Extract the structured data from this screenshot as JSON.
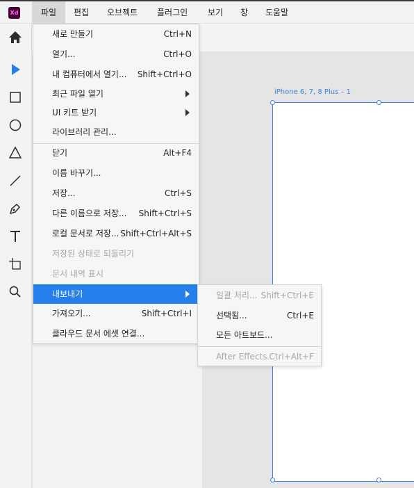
{
  "app": {
    "logo_text": "Xd"
  },
  "menubar": {
    "items": [
      "파일",
      "편집",
      "오브젝트",
      "플러그인",
      "보기",
      "창",
      "도움말"
    ]
  },
  "artboard": {
    "label": "iPhone 6, 7, 8 Plus – 1"
  },
  "file_menu": {
    "items": [
      {
        "label": "새로 만들기",
        "shortcut": "Ctrl+N"
      },
      {
        "label": "열기...",
        "shortcut": "Ctrl+O"
      },
      {
        "label": "내 컴퓨터에서 열기...",
        "shortcut": "Shift+Ctrl+O"
      },
      {
        "label": "최근 파일 열기",
        "shortcut": ""
      },
      {
        "label": "UI 키트 받기",
        "shortcut": ""
      },
      {
        "label": "라이브러리 관리...",
        "shortcut": ""
      },
      {
        "label": "닫기",
        "shortcut": "Alt+F4"
      },
      {
        "label": "이름 바꾸기...",
        "shortcut": ""
      },
      {
        "label": "저장...",
        "shortcut": "Ctrl+S"
      },
      {
        "label": "다른 이름으로 저장...",
        "shortcut": "Shift+Ctrl+S"
      },
      {
        "label": "로컬 문서로 저장...",
        "shortcut": "Shift+Ctrl+Alt+S"
      },
      {
        "label": "저장된 상태로 되돌리기",
        "shortcut": ""
      },
      {
        "label": "문서 내역 표시",
        "shortcut": ""
      },
      {
        "label": "내보내기",
        "shortcut": ""
      },
      {
        "label": "가져오기...",
        "shortcut": "Shift+Ctrl+I"
      },
      {
        "label": "클라우드 문서 에셋 연결...",
        "shortcut": ""
      }
    ]
  },
  "export_submenu": {
    "items": [
      {
        "label": "일괄 처리...",
        "shortcut": "Shift+Ctrl+E"
      },
      {
        "label": "선택됨...",
        "shortcut": "Ctrl+E"
      },
      {
        "label": "모든 아트보드...",
        "shortcut": ""
      },
      {
        "label": "After Effects...",
        "shortcut": "Ctrl+Alt+F"
      }
    ]
  },
  "colors": {
    "accent": "#2680eb",
    "artboard_outline": "#3b82e0",
    "logo_bg": "#470137",
    "logo_fg": "#ff61f6"
  },
  "tools": [
    "home-icon",
    "select-icon",
    "rectangle-icon",
    "ellipse-icon",
    "triangle-icon",
    "line-icon",
    "pen-icon",
    "text-icon",
    "artboard-icon",
    "zoom-icon"
  ]
}
